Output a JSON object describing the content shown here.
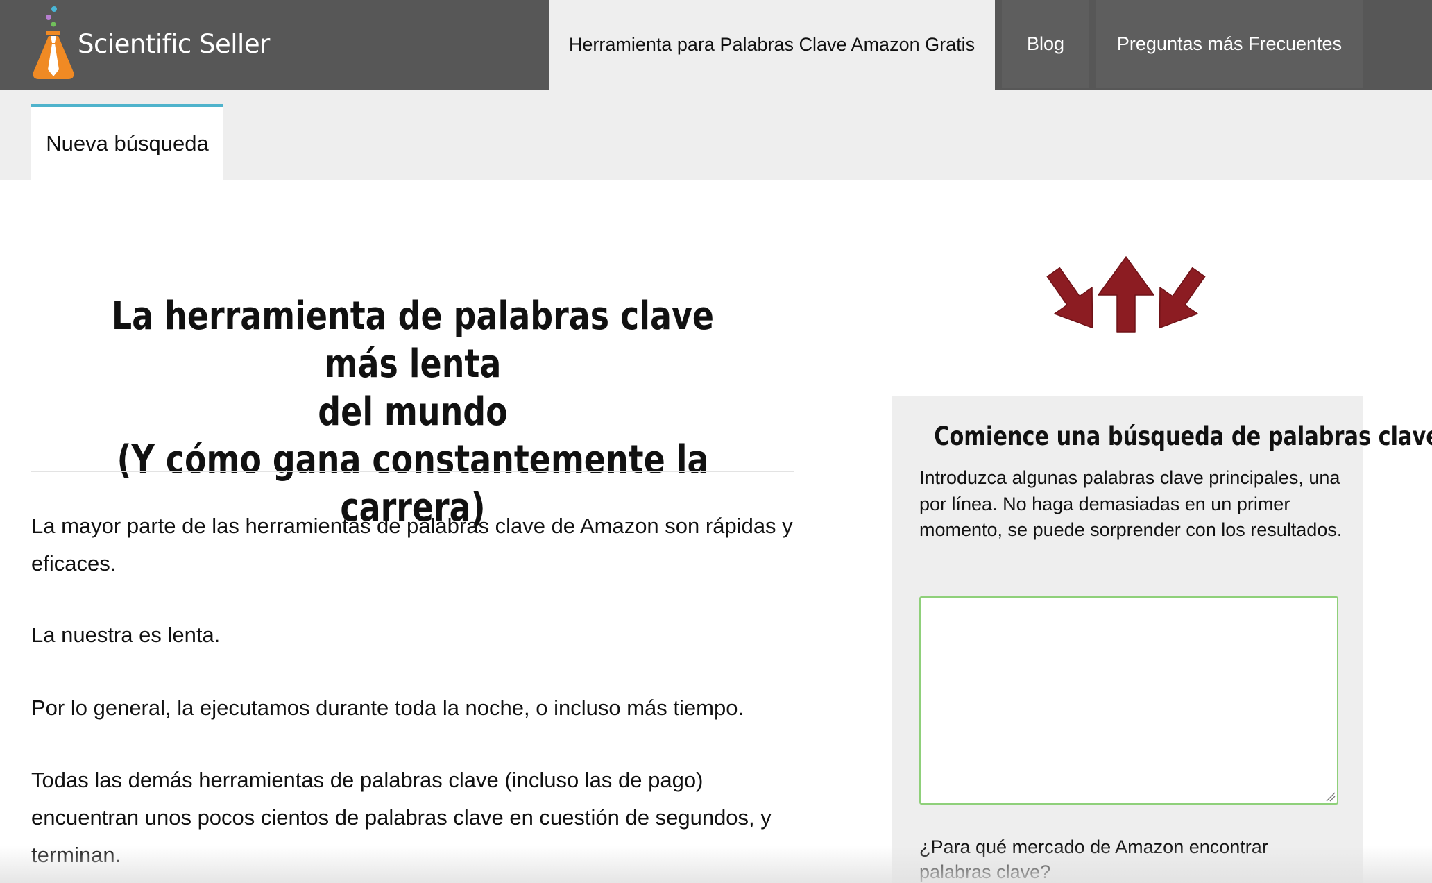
{
  "brand": {
    "name": "Scientific Seller",
    "icon": "flask-necktie-logo-icon",
    "colors": {
      "orange": "#f08a24",
      "dot_blue": "#49b6d6",
      "dot_purple": "#b77fd1",
      "dot_green": "#71c05b"
    }
  },
  "nav": {
    "items": [
      {
        "label": "Herramienta para Palabras Clave Amazon Gratis",
        "active": true
      },
      {
        "label": "Blog",
        "active": false
      },
      {
        "label": "Preguntas más Frecuentes",
        "active": false
      }
    ]
  },
  "subtabs": {
    "new_search": "Nueva búsqueda"
  },
  "article": {
    "headline_line1": "La herramienta de palabras clave más lenta",
    "headline_line2": "del mundo",
    "headline_line3": "(Y cómo gana constantemente la carrera)",
    "paragraphs": [
      "La mayor parte de las herramientas de palabras clave de Amazon son rápidas y eficaces.",
      "La nuestra es lenta.",
      "Por lo general, la ejecutamos durante toda la noche, o incluso más tiempo.",
      "Todas las demás herramientas de palabras clave (incluso las de pago) encuentran unos pocos cientos de palabras clave en cuestión de segundos, y terminan."
    ]
  },
  "decoration": {
    "arrows_icon": "three-down-arrows-icon",
    "arrow_color": "#8c1c22"
  },
  "search_card": {
    "title": "Comience una búsqueda de palabras clave",
    "intro": "Introduzca algunas palabras clave principales, una por línea. No haga demasiadas en un primer momento, se puede sorprender con los resultados.",
    "keywords_value": "",
    "keywords_placeholder": "",
    "market_label": "¿Para qué mercado de Amazon encontrar palabras clave?"
  },
  "colors": {
    "navbar_bg": "#575757",
    "active_tab_bg": "#eeeeee",
    "subtab_accent": "#4fb3cc",
    "input_border": "#8fd07a"
  }
}
